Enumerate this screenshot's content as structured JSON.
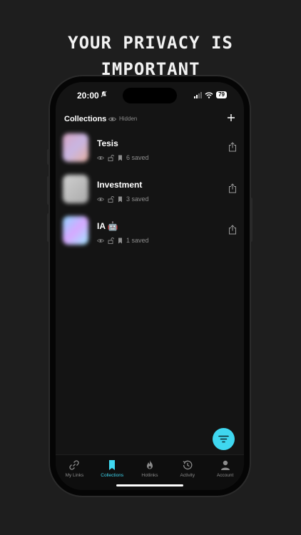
{
  "headline": {
    "line1": "YOUR PRIVACY IS",
    "line2": "IMPORTANT"
  },
  "status_bar": {
    "time": "20:00",
    "battery": "79"
  },
  "header": {
    "title": "Collections",
    "hidden_label": "Hidden",
    "add_icon": "plus-icon"
  },
  "collections": [
    {
      "title": "Tesis",
      "count": "6 saved",
      "thumb_colors": [
        "#d8a6c4",
        "#c8b6e2",
        "#e6b0a0"
      ]
    },
    {
      "title": "Investment",
      "count": "3 saved",
      "thumb_colors": [
        "#cfcfcf",
        "#bdbdbd",
        "#a9a9a9"
      ]
    },
    {
      "title": "IA 🤖",
      "count": "1 saved",
      "thumb_colors": [
        "#8fd6ff",
        "#d7a8ff",
        "#9fe8ff"
      ]
    }
  ],
  "tabs": [
    {
      "label": "My Links",
      "icon": "link-icon",
      "active": false
    },
    {
      "label": "Collections",
      "icon": "bookmark-icon",
      "active": true
    },
    {
      "label": "Hotlinks",
      "icon": "flame-icon",
      "active": false
    },
    {
      "label": "Activity",
      "icon": "history-icon",
      "active": false
    },
    {
      "label": "Account",
      "icon": "person-icon",
      "active": false
    }
  ],
  "colors": {
    "accent": "#3fd7f0",
    "background": "#141414"
  }
}
